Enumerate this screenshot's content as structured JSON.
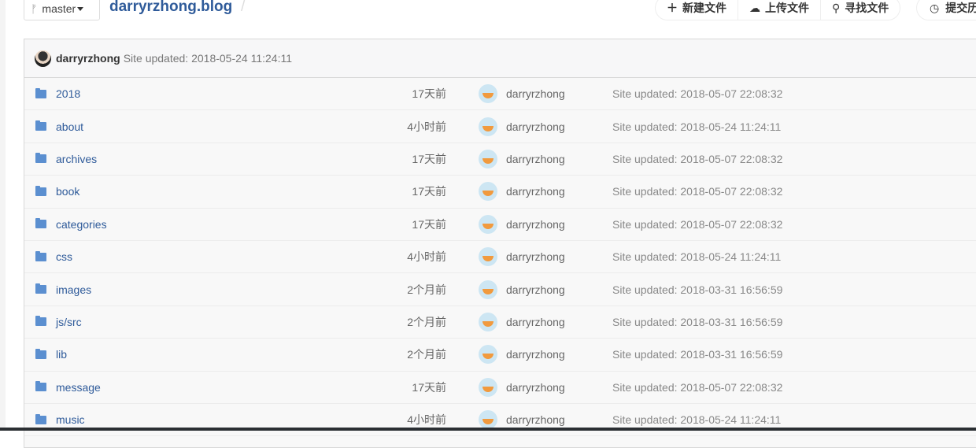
{
  "branch": "master",
  "repo_name": "darryrzhong.blog",
  "slash": "/",
  "actions": [
    {
      "icon": "plus-icon",
      "label": "新建文件"
    },
    {
      "icon": "cloud-upload-icon",
      "label": "上传文件"
    },
    {
      "icon": "search-icon",
      "label": "寻找文件"
    }
  ],
  "history": {
    "icon": "clock-icon",
    "label": "提交历"
  },
  "latest_commit": {
    "author": "darryrzhong",
    "message": "Site updated: 2018-05-24 11:24:11"
  },
  "files": [
    {
      "name": "2018",
      "age": "17天前",
      "author": "darryrzhong",
      "message": "Site updated: 2018-05-07 22:08:32"
    },
    {
      "name": "about",
      "age": "4小时前",
      "author": "darryrzhong",
      "message": "Site updated: 2018-05-24 11:24:11"
    },
    {
      "name": "archives",
      "age": "17天前",
      "author": "darryrzhong",
      "message": "Site updated: 2018-05-07 22:08:32"
    },
    {
      "name": "book",
      "age": "17天前",
      "author": "darryrzhong",
      "message": "Site updated: 2018-05-07 22:08:32"
    },
    {
      "name": "categories",
      "age": "17天前",
      "author": "darryrzhong",
      "message": "Site updated: 2018-05-07 22:08:32"
    },
    {
      "name": "css",
      "age": "4小时前",
      "author": "darryrzhong",
      "message": "Site updated: 2018-05-24 11:24:11"
    },
    {
      "name": "images",
      "age": "2个月前",
      "author": "darryrzhong",
      "message": "Site updated: 2018-03-31 16:56:59"
    },
    {
      "name": "js/src",
      "age": "2个月前",
      "author": "darryrzhong",
      "message": "Site updated: 2018-03-31 16:56:59"
    },
    {
      "name": "lib",
      "age": "2个月前",
      "author": "darryrzhong",
      "message": "Site updated: 2018-03-31 16:56:59"
    },
    {
      "name": "message",
      "age": "17天前",
      "author": "darryrzhong",
      "message": "Site updated: 2018-05-07 22:08:32"
    },
    {
      "name": "music",
      "age": "4小时前",
      "author": "darryrzhong",
      "message": "Site updated: 2018-05-24 11:24:11"
    }
  ]
}
